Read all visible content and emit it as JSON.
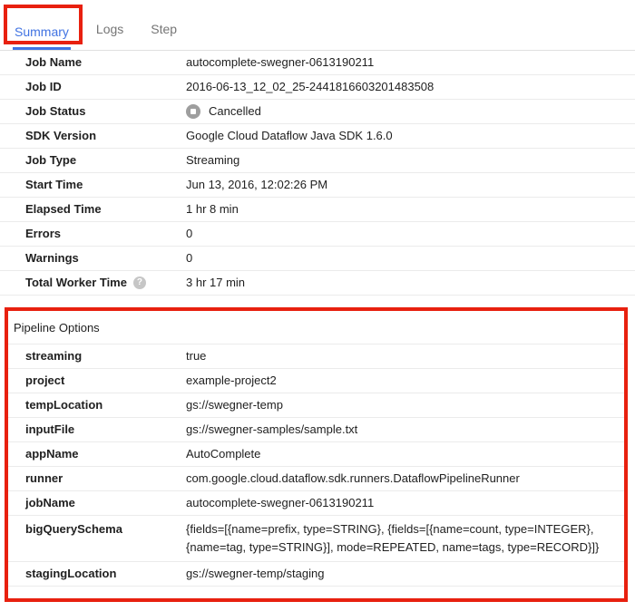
{
  "tabs": {
    "summary": "Summary",
    "logs": "Logs",
    "step": "Step"
  },
  "colors": {
    "active_tab_blue": "#4173e2",
    "annotation_red": "#e8200f",
    "status_icon_gray": "#9e9e9e"
  },
  "summary": {
    "rows": [
      {
        "label": "Job Name",
        "value": "autocomplete-swegner-0613190211"
      },
      {
        "label": "Job ID",
        "value": "2016-06-13_12_02_25-2441816603201483508"
      },
      {
        "label": "Job Status",
        "value": "Cancelled",
        "icon": "cancelled-status-icon"
      },
      {
        "label": "SDK Version",
        "value": "Google Cloud Dataflow Java SDK 1.6.0"
      },
      {
        "label": "Job Type",
        "value": "Streaming"
      },
      {
        "label": "Start Time",
        "value": "Jun 13, 2016, 12:02:26 PM"
      },
      {
        "label": "Elapsed Time",
        "value": "1 hr 8 min"
      },
      {
        "label": "Errors",
        "value": "0"
      },
      {
        "label": "Warnings",
        "value": "0"
      },
      {
        "label": "Total Worker Time",
        "value": "3 hr 17 min",
        "help_icon": "?"
      }
    ]
  },
  "pipeline_options": {
    "title": "Pipeline Options",
    "rows": [
      {
        "label": "streaming",
        "value": "true"
      },
      {
        "label": "project",
        "value": "example-project2"
      },
      {
        "label": "tempLocation",
        "value": "gs://swegner-temp"
      },
      {
        "label": "inputFile",
        "value": "gs://swegner-samples/sample.txt"
      },
      {
        "label": "appName",
        "value": "AutoComplete"
      },
      {
        "label": "runner",
        "value": "com.google.cloud.dataflow.sdk.runners.DataflowPipelineRunner"
      },
      {
        "label": "jobName",
        "value": "autocomplete-swegner-0613190211"
      },
      {
        "label": "bigQuerySchema",
        "value": "{fields=[{name=prefix, type=STRING}, {fields=[{name=count, type=INTEGER}, {name=tag, type=STRING}], mode=REPEATED, name=tags, type=RECORD}]}"
      },
      {
        "label": "stagingLocation",
        "value": "gs://swegner-temp/staging"
      }
    ]
  }
}
